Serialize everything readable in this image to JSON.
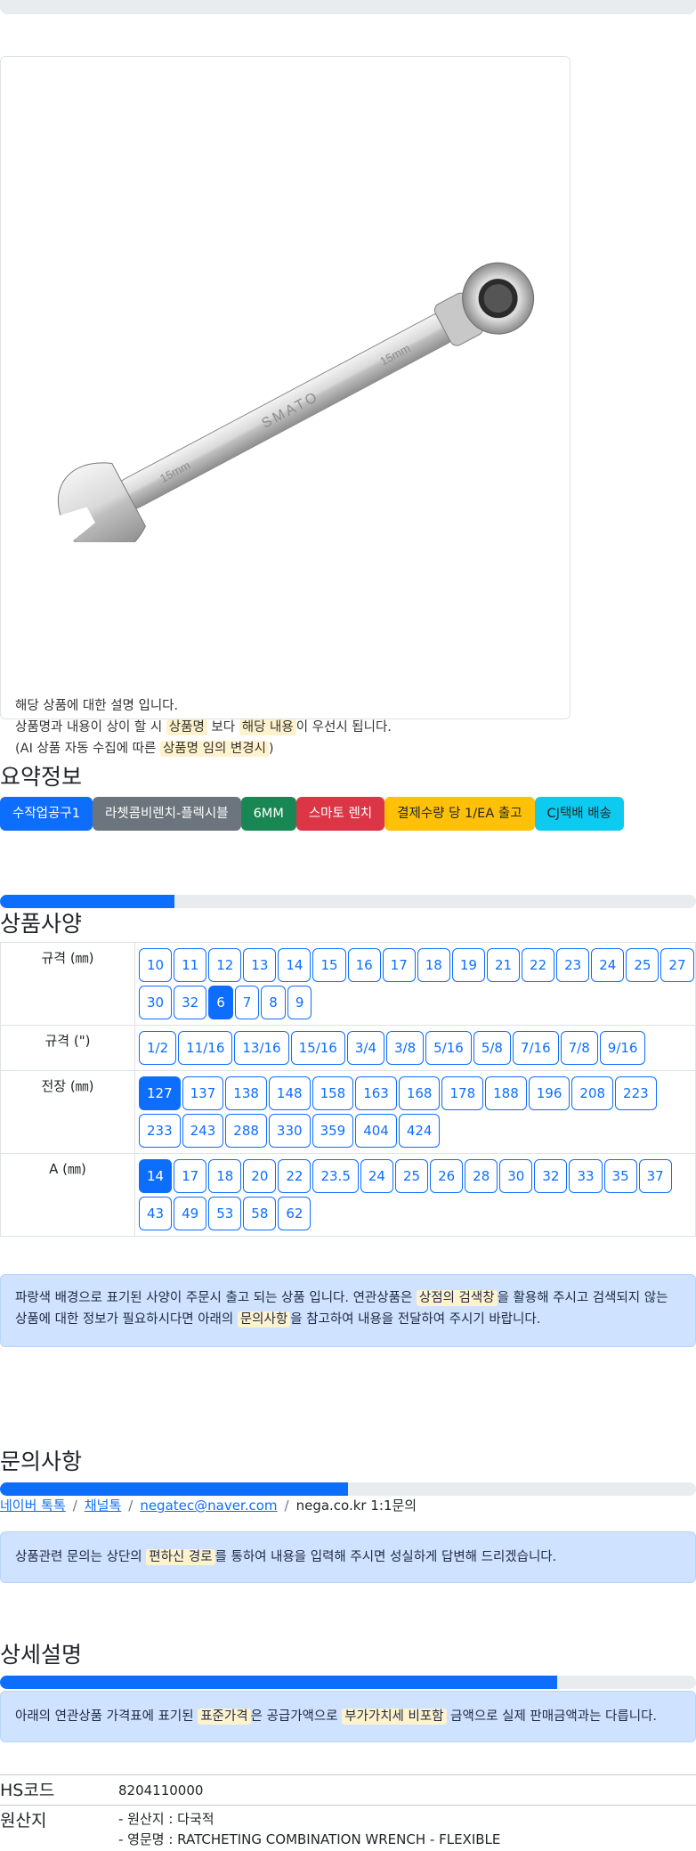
{
  "product_card": {
    "image_brand": "SMATO",
    "image_size": "15mm",
    "desc_line1": "해당 상품에 대한 설명 입니다.",
    "desc_line2_a": "상품명과 내용이 상이 할 시 ",
    "desc_line2_hl1": "상품명",
    "desc_line2_b": " 보다 ",
    "desc_line2_hl2": "해당 내용",
    "desc_line2_c": "이 우선시 됩니다.",
    "desc_line3_a": "(AI 상품 자동 수집에 따른 ",
    "desc_line3_hl": "상품명 임의 변경시",
    "desc_line3_b": ")"
  },
  "summary": {
    "title": "요약정보",
    "badges": [
      {
        "label": "수작업공구1",
        "color": "#0d6efd"
      },
      {
        "label": "라쳇콤비렌치-플렉시블",
        "color": "#6c757d"
      },
      {
        "label": "6MM",
        "color": "#198754"
      },
      {
        "label": "스마토 렌치",
        "color": "#dc3545"
      },
      {
        "label": "결제수량 당 1/EA 출고",
        "color": "#ffc107"
      },
      {
        "label": "CJ택배 배송",
        "color": "#0dcaf0"
      }
    ]
  },
  "spec": {
    "title": "상품사양",
    "progress": 0.25,
    "rows": [
      {
        "label": "규격 (㎜)",
        "options": [
          "10",
          "11",
          "12",
          "13",
          "14",
          "15",
          "16",
          "17",
          "18",
          "19",
          "21",
          "22",
          "23",
          "24",
          "25",
          "27",
          "30",
          "32",
          "6",
          "7",
          "8",
          "9"
        ],
        "selected": "6"
      },
      {
        "label": "규격 (\")",
        "options": [
          "1/2",
          "11/16",
          "13/16",
          "15/16",
          "3/4",
          "3/8",
          "5/16",
          "5/8",
          "7/16",
          "7/8",
          "9/16"
        ],
        "selected": null
      },
      {
        "label": "전장 (㎜)",
        "options": [
          "127",
          "137",
          "138",
          "148",
          "158",
          "163",
          "168",
          "178",
          "188",
          "196",
          "208",
          "223",
          "233",
          "243",
          "288",
          "330",
          "359",
          "404",
          "424"
        ],
        "selected": "127"
      },
      {
        "label": "A (㎜)",
        "options": [
          "14",
          "17",
          "18",
          "20",
          "22",
          "23.5",
          "24",
          "25",
          "26",
          "28",
          "30",
          "32",
          "33",
          "35",
          "37",
          "43",
          "49",
          "53",
          "58",
          "62"
        ],
        "selected": "14"
      }
    ],
    "notice_a": "파랑색 배경으로 표기된 사양이 주문시 출고 되는 상품 입니다. 연관상품은 ",
    "notice_hl1": "상점의 검색창",
    "notice_b": "을 활용해 주시고 검색되지 않는 상품에 대한 정보가 필요하시다면 아래의 ",
    "notice_hl2": "문의사항",
    "notice_c": "을 참고하여 내용을 전달하여 주시기 바랍니다."
  },
  "inquiry": {
    "title": "문의사항",
    "progress": 0.5,
    "links": [
      "네이버 톡톡",
      "채널톡",
      "negatec@naver.com"
    ],
    "last": "nega.co.kr 1:1문의",
    "sep": "/",
    "notice_a": "상품관련 문의는 상단의 ",
    "notice_hl": "편하신 경로",
    "notice_b": "를 통하여 내용을 입력해 주시면 성실하게 답변해 드리겠습니다."
  },
  "detail": {
    "title": "상세설명",
    "progress": 0.8,
    "notice_a": "아래의 연관상품 가격표에 표기된 ",
    "notice_hl1": "표준가격",
    "notice_b": "은 공급가액으로 ",
    "notice_hl2": "부가가치세 비포함",
    "notice_c": " 금액으로 실제 판매금액과는 다릅니다.",
    "hs_label": "HS코드",
    "hs_value": "8204110000",
    "origin_label": "원산지",
    "origin_line1": "- 원산지 : 다국적",
    "origin_line2": "- 영문명 : RATCHETING COMBINATION WRENCH - FLEXIBLE"
  }
}
